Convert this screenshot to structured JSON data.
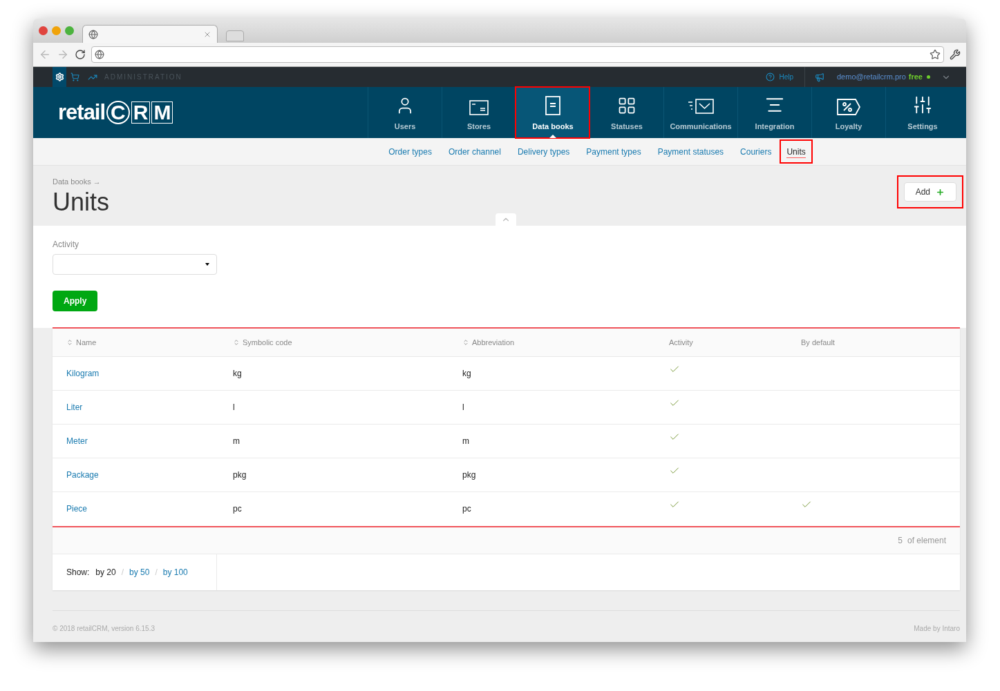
{
  "admin_bar": {
    "label": "ADMINISTRATION",
    "help": "Help",
    "user": "demo@retailcrm.pro",
    "plan": "free"
  },
  "logo": {
    "text": "retail",
    "mark": [
      "C",
      "R",
      "M"
    ]
  },
  "nav": [
    {
      "label": "Users",
      "selected": false,
      "highlighted": false
    },
    {
      "label": "Stores",
      "selected": false,
      "highlighted": false
    },
    {
      "label": "Data books",
      "selected": true,
      "highlighted": true
    },
    {
      "label": "Statuses",
      "selected": false,
      "highlighted": false
    },
    {
      "label": "Communications",
      "selected": false,
      "highlighted": false
    },
    {
      "label": "Integration",
      "selected": false,
      "highlighted": false
    },
    {
      "label": "Loyalty",
      "selected": false,
      "highlighted": false
    },
    {
      "label": "Settings",
      "selected": false,
      "highlighted": false
    }
  ],
  "subnav": [
    {
      "label": "Order types",
      "selected": false,
      "highlighted": false
    },
    {
      "label": "Order channel",
      "selected": false,
      "highlighted": false
    },
    {
      "label": "Delivery types",
      "selected": false,
      "highlighted": false
    },
    {
      "label": "Payment types",
      "selected": false,
      "highlighted": false
    },
    {
      "label": "Payment statuses",
      "selected": false,
      "highlighted": false
    },
    {
      "label": "Couriers",
      "selected": false,
      "highlighted": false
    },
    {
      "label": "Units",
      "selected": true,
      "highlighted": true
    }
  ],
  "header": {
    "breadcrumb": "Data books →",
    "title": "Units",
    "add_button": {
      "label": "Add",
      "highlighted": true
    }
  },
  "filter": {
    "label": "Activity",
    "apply": "Apply"
  },
  "table": {
    "columns": [
      {
        "label": "Name",
        "sortable": true
      },
      {
        "label": "Symbolic code",
        "sortable": true
      },
      {
        "label": "Abbreviation",
        "sortable": true
      },
      {
        "label": "Activity",
        "sortable": false
      },
      {
        "label": "By default",
        "sortable": false
      }
    ],
    "rows": [
      {
        "name": "Kilogram",
        "code": "kg",
        "abbreviation": "kg",
        "active": true,
        "default": false
      },
      {
        "name": "Liter",
        "code": "l",
        "abbreviation": "l",
        "active": true,
        "default": false
      },
      {
        "name": "Meter",
        "code": "m",
        "abbreviation": "m",
        "active": true,
        "default": false
      },
      {
        "name": "Package",
        "code": "pkg",
        "abbreviation": "pkg",
        "active": true,
        "default": false
      },
      {
        "name": "Piece",
        "code": "pc",
        "abbreviation": "pc",
        "active": true,
        "default": true
      }
    ],
    "count": "5",
    "count_label": "of element"
  },
  "pagination": {
    "label": "Show:",
    "separator": "/",
    "options": [
      {
        "label": "by 20",
        "selected": true
      },
      {
        "label": "by 50",
        "selected": false
      },
      {
        "label": "by 100",
        "selected": false
      }
    ]
  },
  "footer": {
    "copyright": "© 2018 retailCRM, version 6.15.3",
    "made_by": "Made by Intaro"
  }
}
